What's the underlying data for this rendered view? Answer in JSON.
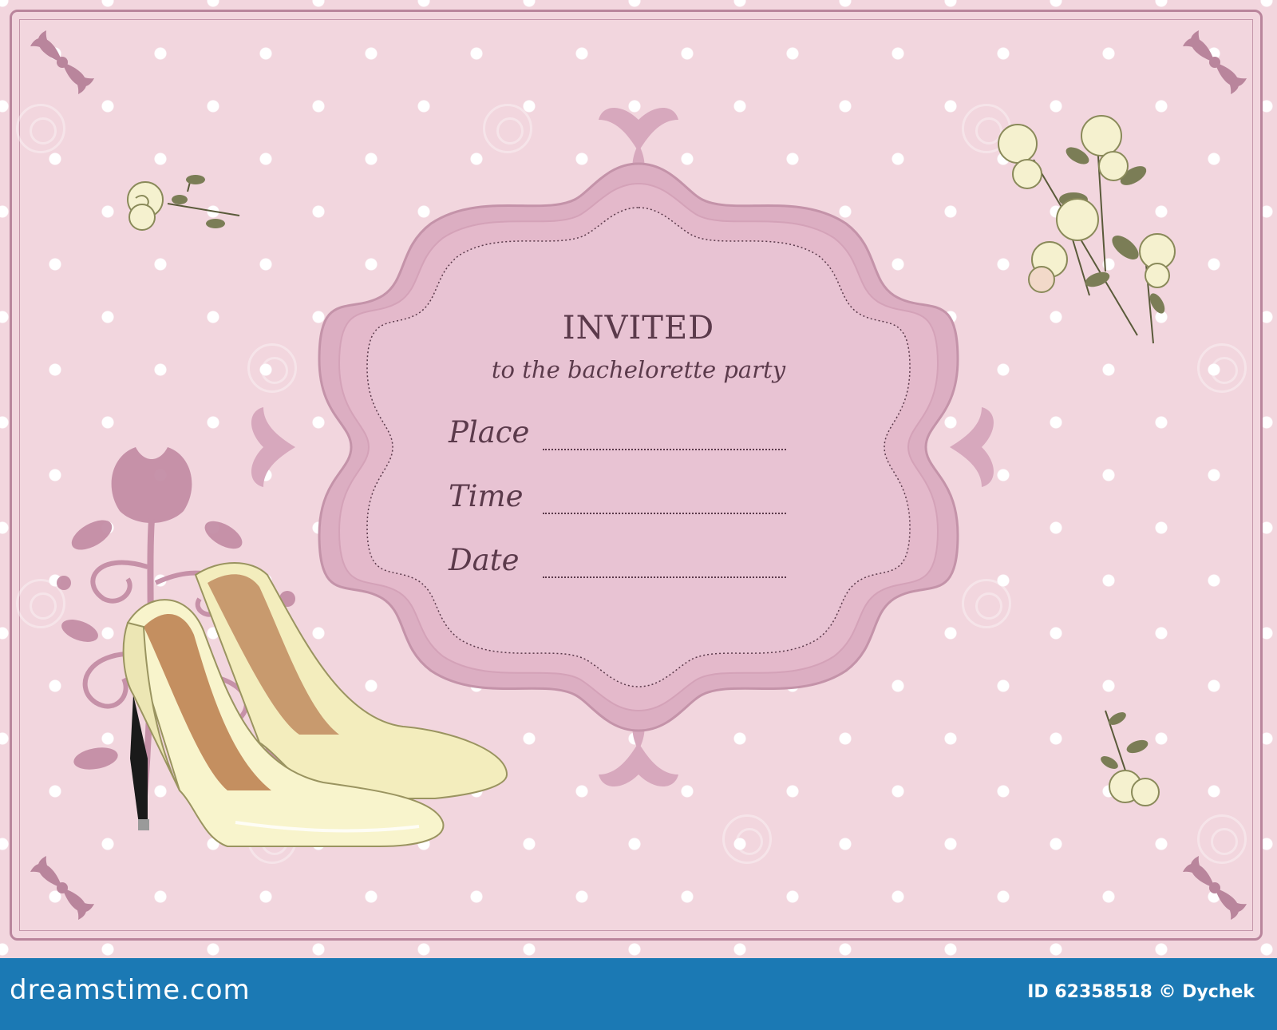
{
  "invitation": {
    "title": "INVITED",
    "subtitle": "to the bachelorette party",
    "fields": [
      {
        "label": "Place"
      },
      {
        "label": "Time"
      },
      {
        "label": "Date"
      }
    ]
  },
  "footer": {
    "logo": "dreamstime.com",
    "id_text": "ID 62358518 © Dychek"
  },
  "colors": {
    "background": "#f2d6de",
    "dots": "#ffffff",
    "frame": "#b9859c",
    "label_fill": "#e8bfcf",
    "text": "#5b3a4b",
    "shoe": "#f7f2c4",
    "rose": "#f5f1cf",
    "leaf": "#7b7d56",
    "footer": "#1b79b4"
  },
  "icons": [
    "corner-ornament-icon",
    "rose-bouquet-icon",
    "rose-sprig-icon",
    "high-heel-shoes-icon",
    "floral-swirl-icon",
    "fleur-ornament-icon"
  ]
}
